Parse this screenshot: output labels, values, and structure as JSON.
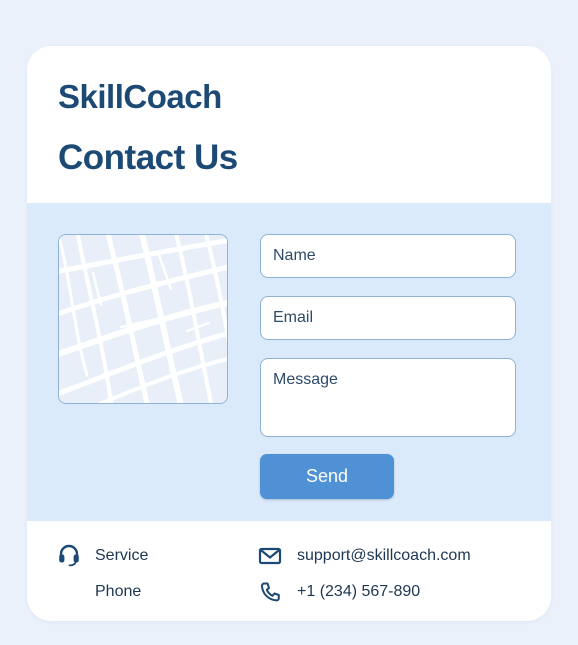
{
  "brand": "SkillCoach",
  "page_title": "Contact Us",
  "form": {
    "name_placeholder": "Name",
    "email_placeholder": "Email",
    "message_placeholder": "Message",
    "send_label": "Send"
  },
  "footer": {
    "service_label": "Service",
    "phone_label": "Phone",
    "email_value": "support@skillcoach.com",
    "phone_value": "+1 (234) 567-890"
  },
  "icons": {
    "map": "map-icon",
    "service": "headset-icon",
    "email": "mail-icon",
    "phone": "phone-icon"
  },
  "colors": {
    "page_background": "#eaf1fb",
    "card_background": "#ffffff",
    "form_band": "#dbeafa",
    "heading": "#1d4a75",
    "accent": "#4f91d4",
    "field_border": "#8fb2d6"
  }
}
